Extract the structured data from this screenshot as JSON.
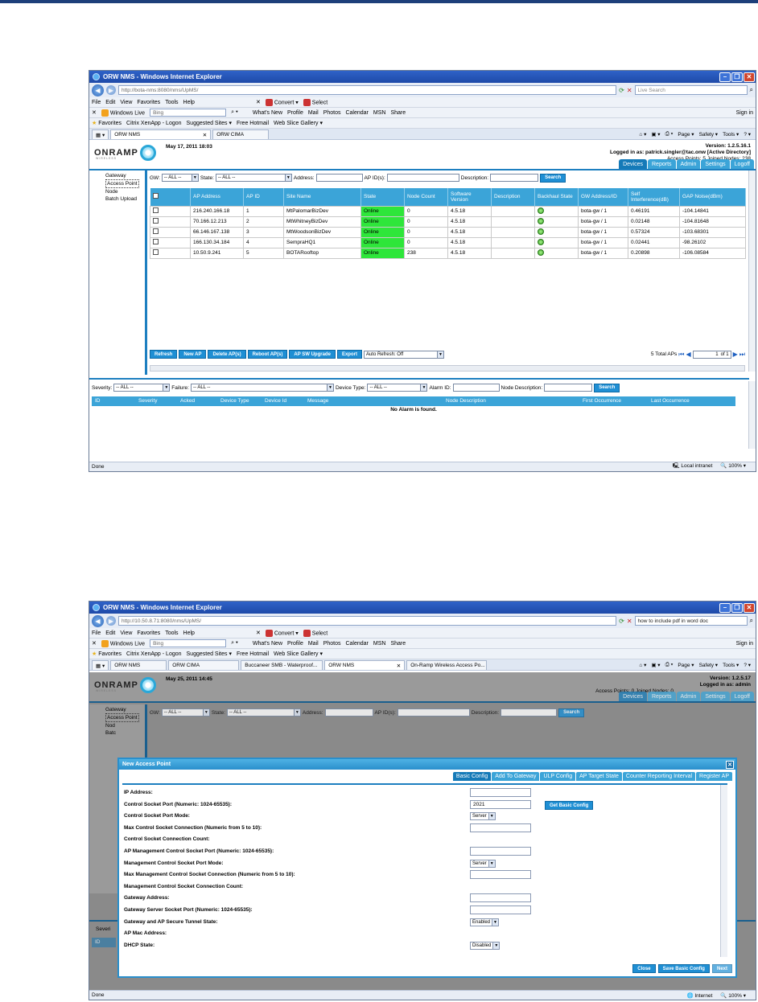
{
  "screen1": {
    "window_title": "ORW NMS - Windows Internet Explorer",
    "url": "http://bota-nms:8080/nms/UpMS/",
    "search_placeholder": "Live Search",
    "menu": [
      "File",
      "Edit",
      "View",
      "Favorites",
      "Tools",
      "Help"
    ],
    "convert_label": "Convert",
    "select_label": "Select",
    "live_label": "Windows Live",
    "bing_placeholder": "Bing",
    "live_links": [
      "What's New",
      "Profile",
      "Mail",
      "Photos",
      "Calendar",
      "MSN",
      "Share"
    ],
    "signin": "Sign in",
    "favorites_label": "Favorites",
    "fav_links": [
      "Citrix XenApp - Logon",
      "Suggested Sites ▾",
      "Free Hotmail",
      "Web Slice Gallery ▾"
    ],
    "tabs": [
      {
        "label": "ORW NMS",
        "active": true
      },
      {
        "label": "ORW CIMA",
        "active": false
      }
    ],
    "tools": [
      "Page ▾",
      "Safety ▾",
      "Tools ▾"
    ],
    "app": {
      "date": "May 17, 2011 18:03",
      "version": "Version: 1.2.5.16.1",
      "logged_in": "Logged in as: patrick.singler@tac.onw [Active Directory]",
      "access_points": "Access Points: 5 Joined Nodes: 238",
      "logo": "ONRAMP",
      "logo_sub": "WIRELESS",
      "tabs": [
        {
          "label": "Devices",
          "active": true
        },
        {
          "label": "Reports",
          "active": false
        },
        {
          "label": "Admin",
          "active": false
        },
        {
          "label": "Settings",
          "active": false
        },
        {
          "label": "Logoff",
          "active": false
        }
      ],
      "sidebar": [
        "Gateway",
        "Access Point",
        "Node",
        "Batch Upload"
      ],
      "filters": {
        "gw": "GW:",
        "gw_value": "-- ALL --",
        "state": "State:",
        "state_value": "-- ALL --",
        "address": "Address:",
        "apids": "AP ID(s):",
        "description": "Description:",
        "search": "Search"
      },
      "columns": [
        "",
        "AP Address",
        "AP ID",
        "Site Name",
        "State",
        "Node Count",
        "Software Version",
        "Description",
        "Backhaul State",
        "GW Address/ID",
        "Self Interference(dB)",
        "GAP Noise(dBm)"
      ],
      "rows": [
        {
          "address": "216.240.166.18",
          "id": "1",
          "site": "MtPalomarBizDev",
          "state": "Online",
          "nodes": "0",
          "sw": "4.5.18",
          "desc": "",
          "gw": "bota-gw / 1",
          "self": "0.46191",
          "gap": "-104.14841"
        },
        {
          "address": "70.166.12.213",
          "id": "2",
          "site": "MtWhitneyBizDev",
          "state": "Online",
          "nodes": "0",
          "sw": "4.5.18",
          "desc": "",
          "gw": "bota-gw / 1",
          "self": "0.02148",
          "gap": "-104.81648"
        },
        {
          "address": "66.146.167.138",
          "id": "3",
          "site": "MtWoodsonBizDev",
          "state": "Online",
          "nodes": "0",
          "sw": "4.5.18",
          "desc": "",
          "gw": "bota-gw / 1",
          "self": "0.57324",
          "gap": "-103.68301"
        },
        {
          "address": "166.130.34.184",
          "id": "4",
          "site": "SempraHQ1",
          "state": "Online",
          "nodes": "0",
          "sw": "4.5.18",
          "desc": "",
          "gw": "bota-gw / 1",
          "self": "0.02441",
          "gap": "-98.26102"
        },
        {
          "address": "10.50.9.241",
          "id": "5",
          "site": "BOTARooftop",
          "state": "Online",
          "nodes": "238",
          "sw": "4.5.18",
          "desc": "",
          "gw": "bota-gw / 1",
          "self": "0.20898",
          "gap": "-106.08584"
        }
      ],
      "buttons": [
        "Refresh",
        "New AP",
        "Delete AP(s)",
        "Reboot AP(s)",
        "AP SW Upgrade",
        "Export"
      ],
      "auto_refresh": "Auto Refresh: Off",
      "total": "5 Total APs",
      "page": "1",
      "of": "of 1",
      "alarm_filters": {
        "severity": "Severity:",
        "severity_value": "-- ALL --",
        "failure": "Failure:",
        "failure_value": "-- ALL --",
        "device_type": "Device Type:",
        "device_value": "-- ALL --",
        "alarm_id": "Alarm ID:",
        "node_desc": "Node Description:",
        "search": "Search"
      },
      "alarm_columns": [
        "ID",
        "Severity",
        "Acked",
        "Device Type",
        "Device Id",
        "Message",
        "Node Description",
        "First Occurrence",
        "Last Occurrence"
      ],
      "no_alarm": "No Alarm is found."
    },
    "status": {
      "left": "Done",
      "zone": "Local intranet",
      "zoom": "100%"
    }
  },
  "screen2": {
    "window_title": "ORW NMS - Windows Internet Explorer",
    "url": "http://10.50.8.71:8080/nms/UpMS/",
    "search_text": "how to include pdf in word doc",
    "tabs": [
      {
        "label": "ORW NMS",
        "active": false
      },
      {
        "label": "ORW CIMA",
        "active": false
      },
      {
        "label": "Buccaneer SMB - Waterproof...",
        "active": false
      },
      {
        "label": "ORW NMS",
        "active": true
      },
      {
        "label": "On-Ramp Wireless Access Po...",
        "active": false
      }
    ],
    "app": {
      "date": "May 25, 2011 14:45",
      "version": "Version: 1.2.5.17",
      "logged_in": "Logged in as: admin",
      "access_points": "Access Points: 0 Joined Nodes: 0",
      "sidebar": [
        "Gateway",
        "Access Point",
        "Node",
        "Batch Upload"
      ],
      "sidebar_visible": [
        "Gateway",
        "Access Point",
        "Nod",
        "Batc"
      ],
      "severity_stub": "Severi",
      "id_stub": "ID"
    },
    "dialog": {
      "title": "New Access Point",
      "tabs": [
        {
          "label": "Basic Config",
          "active": true
        },
        {
          "label": "Add To Gateway",
          "active": false
        },
        {
          "label": "ULP Config",
          "active": false
        },
        {
          "label": "AP Target State",
          "active": false
        },
        {
          "label": "Counter Reporting Interval",
          "active": false
        },
        {
          "label": "Register AP",
          "active": false
        }
      ],
      "get_config": "Get Basic Config",
      "fields": [
        {
          "label": "IP Address:",
          "type": "text",
          "value": ""
        },
        {
          "label": "Control Socket Port (Numeric: 1024-65535):",
          "type": "text",
          "value": "2021"
        },
        {
          "label": "Control Socket Port Mode:",
          "type": "select",
          "value": "Server"
        },
        {
          "label": "Max Control Socket Connection (Numeric from 5 to 10):",
          "type": "text",
          "value": ""
        },
        {
          "label": "Control Socket Connection Count:",
          "type": "none",
          "value": ""
        },
        {
          "label": "AP Management Control Socket Port (Numeric: 1024-65535):",
          "type": "text",
          "value": ""
        },
        {
          "label": "Management Control Socket Port Mode:",
          "type": "select",
          "value": "Server"
        },
        {
          "label": "Max Management Control Socket Connection (Numeric from 5 to 10):",
          "type": "text",
          "value": ""
        },
        {
          "label": "Management Control Socket Connection Count:",
          "type": "none",
          "value": ""
        },
        {
          "label": "Gateway Address:",
          "type": "text",
          "value": ""
        },
        {
          "label": "Gateway Server Socket Port (Numeric: 1024-65535):",
          "type": "text",
          "value": ""
        },
        {
          "label": "Gateway and AP Secure Tunnel State:",
          "type": "select",
          "value": "Enabled"
        },
        {
          "label": "AP Mac Address:",
          "type": "none",
          "value": ""
        },
        {
          "label": "DHCP State:",
          "type": "select",
          "value": "Disabled"
        }
      ],
      "buttons": [
        "Close",
        "Save Basic Config",
        "Next"
      ]
    },
    "status": {
      "left": "Done",
      "zone": "Internet",
      "zoom": "100%"
    }
  }
}
